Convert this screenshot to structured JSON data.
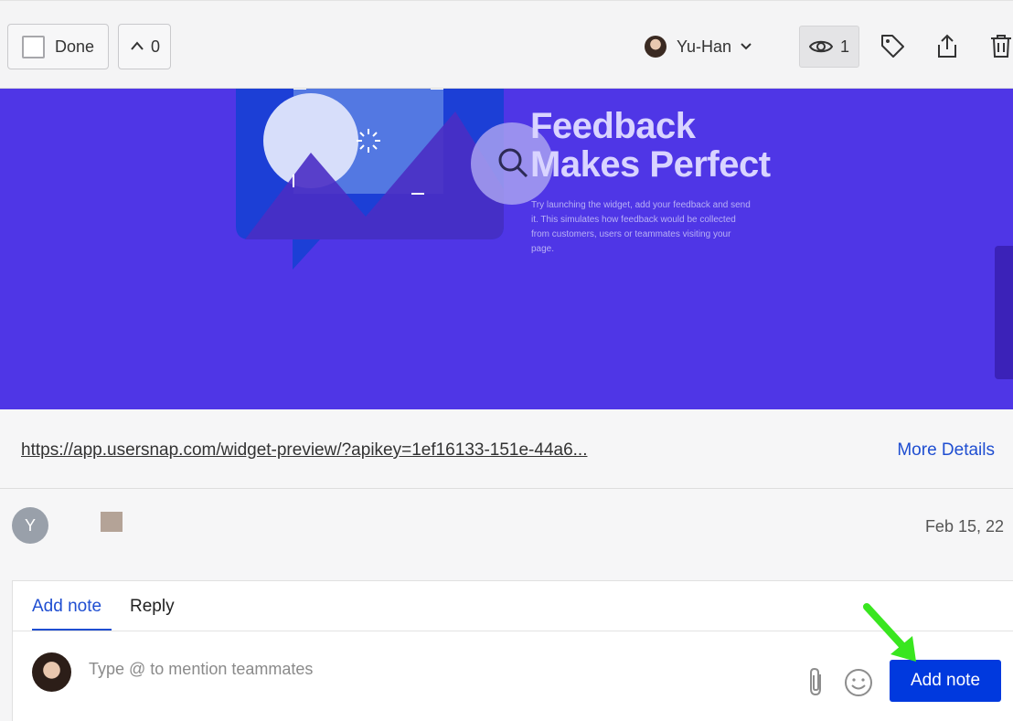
{
  "toolbar": {
    "done_label": "Done",
    "vote_count": "0",
    "assignee_name": "Yu-Han",
    "views_count": "1",
    "icons": [
      "tag-icon",
      "share-icon",
      "trash-icon"
    ]
  },
  "banner": {
    "title_line1": "Feedback",
    "title_line2": "Makes Perfect",
    "description": "Try launching the widget, add your feedback and send it. This simulates how feedback would be collected from customers, users or teammates visiting your page."
  },
  "details": {
    "url": "https://app.usersnap.com/widget-preview/?apikey=1ef16133-151e-44a6...",
    "more_details_label": "More Details"
  },
  "comment": {
    "avatar_initial": "Y",
    "date": "Feb 15, 22"
  },
  "composer": {
    "tab_add_note": "Add note",
    "tab_reply": "Reply",
    "placeholder": "Type @ to mention teammates",
    "submit_label": "Add note"
  },
  "colors": {
    "accent": "#1f4ed1",
    "button": "#0039de",
    "banner": "#4f36e6",
    "pointer": "#39e61f"
  }
}
